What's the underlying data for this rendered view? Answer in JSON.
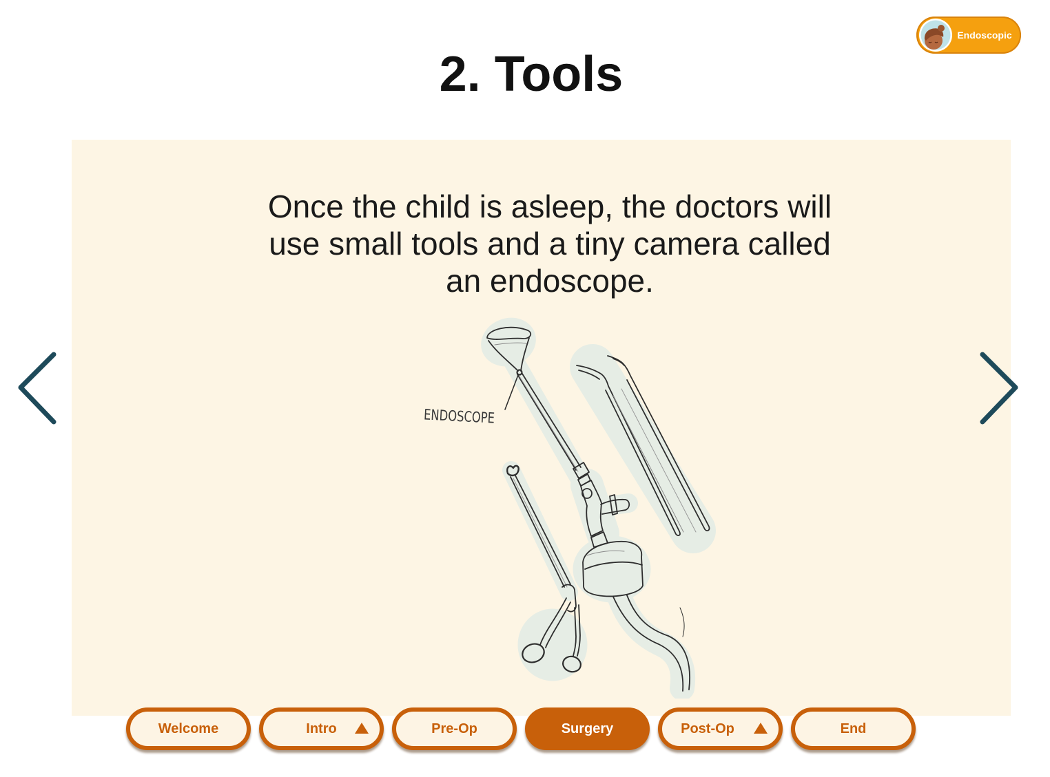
{
  "header": {
    "title": "2. Tools"
  },
  "mode_badge": {
    "label": "Endoscopic",
    "avatar_icon": "child-avatar-icon"
  },
  "slide": {
    "text": "Once the child is asleep, the doctors will use small tools and a tiny camera called an endoscope.",
    "illustration_label": "ENDOSCOPE"
  },
  "arrows": {
    "prev_icon": "chevron-left-icon",
    "next_icon": "chevron-right-icon"
  },
  "nav_tabs": [
    {
      "label": "Welcome",
      "active": false,
      "has_submenu": false
    },
    {
      "label": "Intro",
      "active": false,
      "has_submenu": true
    },
    {
      "label": "Pre-Op",
      "active": false,
      "has_submenu": false
    },
    {
      "label": "Surgery",
      "active": true,
      "has_submenu": false
    },
    {
      "label": "Post-Op",
      "active": false,
      "has_submenu": true
    },
    {
      "label": "End",
      "active": false,
      "has_submenu": false
    }
  ],
  "submenu_icon": "triangle-up-icon",
  "colors": {
    "accent": "#c8600a",
    "badge": "#f5a00f",
    "panel": "#fdf5e4",
    "arrow": "#1e4a5a"
  }
}
